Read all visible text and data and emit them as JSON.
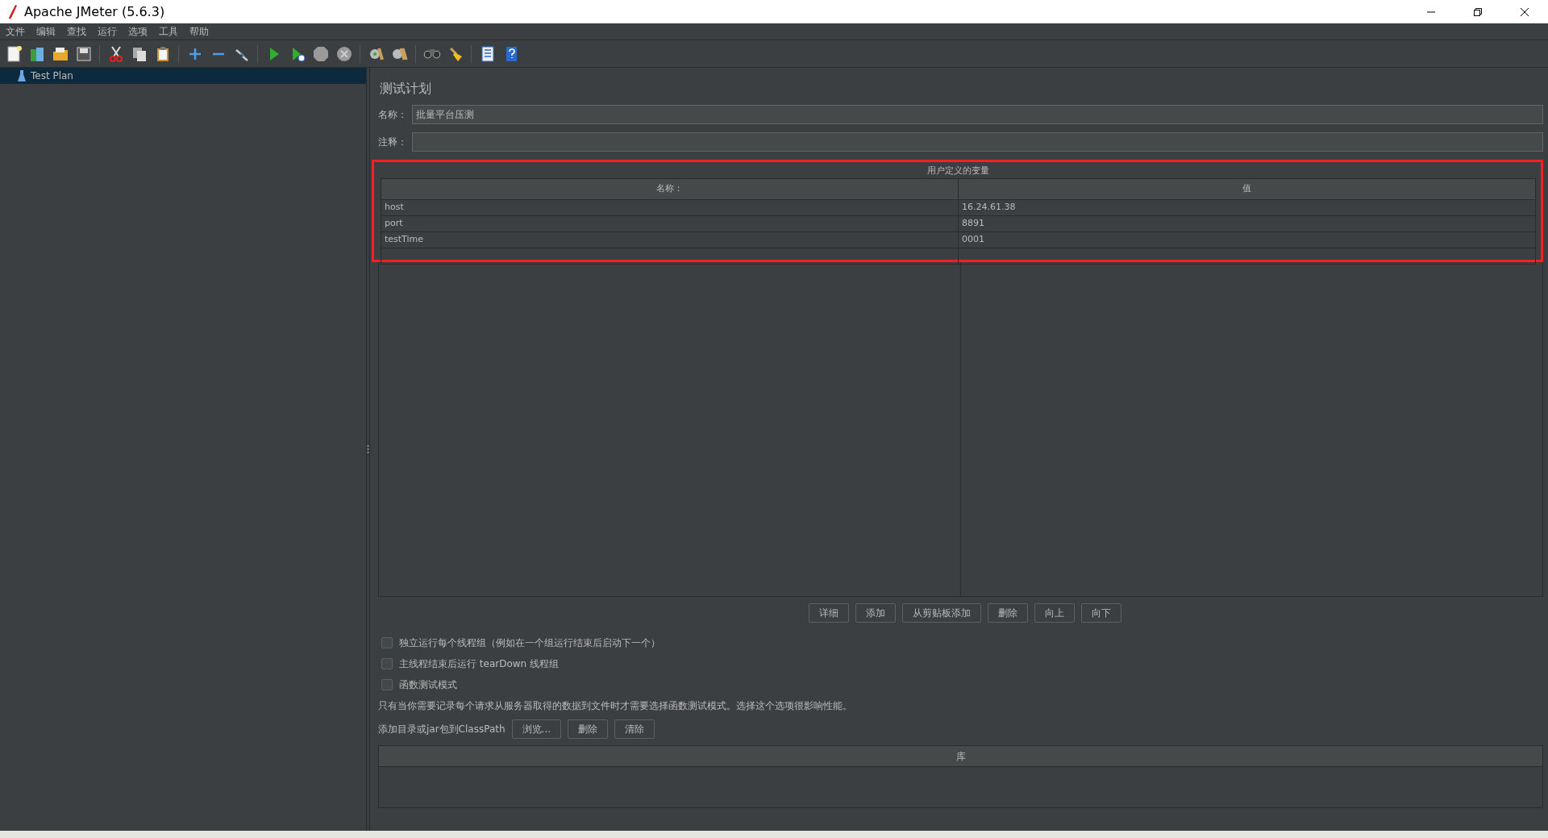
{
  "window": {
    "title": "Apache JMeter (5.6.3)"
  },
  "menu": [
    "文件",
    "编辑",
    "查找",
    "运行",
    "选项",
    "工具",
    "帮助"
  ],
  "tree": {
    "items": [
      {
        "label": "Test Plan",
        "selected": true
      }
    ]
  },
  "panel": {
    "title": "测试计划",
    "name_label": "名称：",
    "name_value": "批量平台压测",
    "comment_label": "注释："
  },
  "variables": {
    "title": "用户定义的变量",
    "columns": [
      "名称：",
      "值"
    ],
    "rows": [
      {
        "name": "host",
        "value": "16.24.61.38"
      },
      {
        "name": "port",
        "value": "8891"
      },
      {
        "name": "testTime",
        "value": "0001"
      }
    ],
    "highlighted": true,
    "buttons": [
      "详细",
      "添加",
      "从剪贴板添加",
      "删除",
      "向上",
      "向下"
    ]
  },
  "options": [
    {
      "label": "独立运行每个线程组（例如在一个组运行结束后启动下一个）",
      "checked": false
    },
    {
      "label": "主线程结束后运行 tearDown 线程组",
      "checked": false
    },
    {
      "label": "函数测试模式",
      "checked": false
    }
  ],
  "note": "只有当你需要记录每个请求从服务器取得的数据到文件时才需要选择函数测试模式。选择这个选项很影响性能。",
  "classpath": {
    "label": "添加目录或jar包到ClassPath",
    "buttons": [
      "浏览...",
      "删除",
      "清除"
    ],
    "column": "库"
  }
}
